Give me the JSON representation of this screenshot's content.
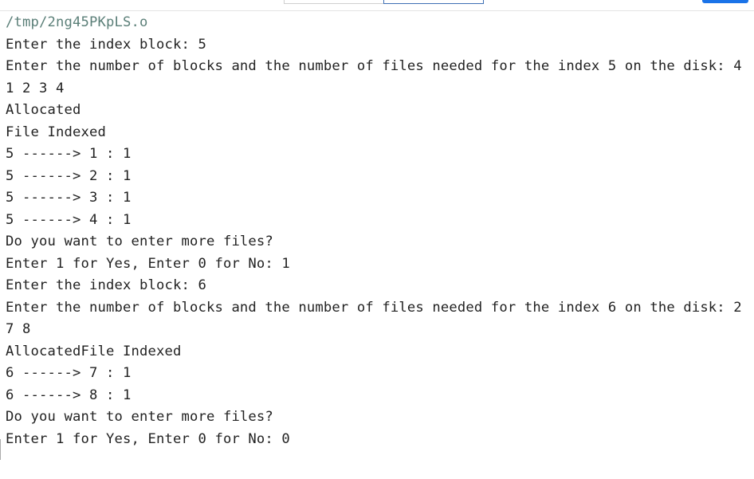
{
  "terminal": {
    "lines": [
      "/tmp/2ng45PKpLS.o",
      "Enter the index block: 5",
      "Enter the number of blocks and the number of files needed for the index 5 on the disk: 4",
      "1 2 3 4",
      "Allocated",
      "File Indexed",
      "5 ------> 1 : 1",
      "5 ------> 2 : 1",
      "5 ------> 3 : 1",
      "5 ------> 4 : 1",
      "Do you want to enter more files?",
      "Enter 1 for Yes, Enter 0 for No: 1",
      "Enter the index block: 6",
      "Enter the number of blocks and the number of files needed for the index 6 on the disk: 2",
      "7 8",
      "AllocatedFile Indexed",
      "6 ------> 7 : 1",
      "6 ------> 8 : 1",
      "Do you want to enter more files?",
      "Enter 1 for Yes, Enter 0 for No: 0"
    ]
  }
}
